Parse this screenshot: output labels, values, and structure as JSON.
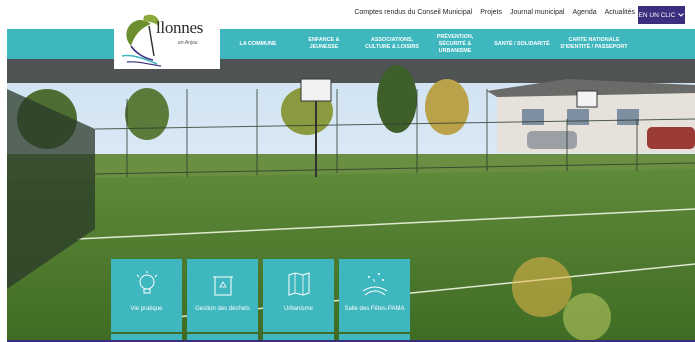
{
  "top_links": [
    "Comptes rendus du Conseil Municipal",
    "Projets",
    "Journal municipal",
    "Agenda",
    "Actualités"
  ],
  "en_un_clic": "EN UN CLIC",
  "logo": {
    "title": "llonnes",
    "subtitle": "en Anjou"
  },
  "nav": [
    "LA COMMUNE",
    "ENFANCE & JEUNESSE",
    "ASSOCIATIONS, CULTURE & LOISIRS",
    "PRÉVENTION, SÉCURITÉ & URBANISME",
    "SANTÉ / SOLIDARITÉ",
    "CARTE NATIONALE D'IDENTITÉ / PASSEPORT"
  ],
  "tiles": [
    {
      "label": "Vie pratique",
      "icon": "lightbulb-icon"
    },
    {
      "label": "Gestion des déchets",
      "icon": "recycling-bin-icon"
    },
    {
      "label": "Urbanisme",
      "icon": "map-icon"
    },
    {
      "label": "Salle des Fêtes-PAMA",
      "icon": "festive-icon"
    }
  ],
  "colors": {
    "teal": "#3fb7bf",
    "purple": "#3a2f7e"
  }
}
